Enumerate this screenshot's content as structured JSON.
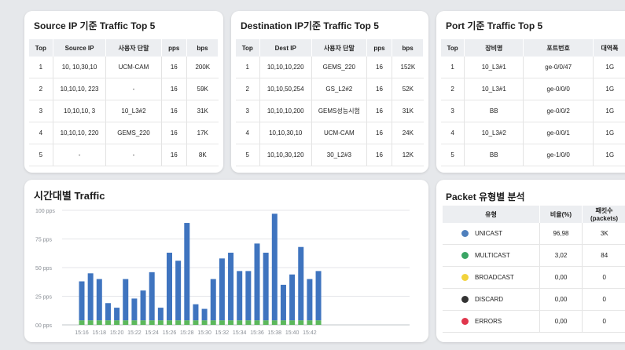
{
  "source_card": {
    "title": "Source IP 기준 Traffic Top 5",
    "headers": [
      "Top",
      "Source IP",
      "사용자 단말",
      "pps",
      "bps"
    ],
    "rows": [
      [
        "1",
        "10, 10,30,10",
        "UCM-CAM",
        "16",
        "200K"
      ],
      [
        "2",
        "10,10,10, 223",
        "-",
        "16",
        "59K"
      ],
      [
        "3",
        "10,10,10, 3",
        "10_L3#2",
        "16",
        "31K"
      ],
      [
        "4",
        "10,10,10, 220",
        "GEMS_220",
        "16",
        "17K"
      ],
      [
        "5",
        "-",
        "-",
        "16",
        "8K"
      ]
    ]
  },
  "dest_card": {
    "title": "Destination IP기준 Traffic Top 5",
    "headers": [
      "Top",
      "Dest IP",
      "사용자 단말",
      "pps",
      "bps"
    ],
    "rows": [
      [
        "1",
        "10,10,10,220",
        "GEMS_220",
        "16",
        "152K"
      ],
      [
        "2",
        "10,10,50,254",
        "GS_L2#2",
        "16",
        "52K"
      ],
      [
        "3",
        "10,10,10,200",
        "GEMS성능시험",
        "16",
        "31K"
      ],
      [
        "4",
        "10,10,30,10",
        "UCM-CAM",
        "16",
        "24K"
      ],
      [
        "5",
        "10,10,30,120",
        "30_L2#3",
        "16",
        "12K"
      ]
    ]
  },
  "port_card": {
    "title": "Port 기준 Traffic Top 5",
    "headers": [
      "Top",
      "장비명",
      "포트번호",
      "대역폭"
    ],
    "rows": [
      [
        "1",
        "10_L3#1",
        "ge-0/0/47",
        "1G"
      ],
      [
        "2",
        "10_L3#1",
        "ge-0/0/0",
        "1G"
      ],
      [
        "3",
        "BB",
        "ge-0/0/2",
        "1G"
      ],
      [
        "4",
        "10_L3#2",
        "ge-0/0/1",
        "1G"
      ],
      [
        "5",
        "BB",
        "ge-1/0/0",
        "1G"
      ]
    ]
  },
  "packet_card": {
    "title": "Packet 유형별 분석",
    "headers": [
      "유형",
      "비율(%)",
      "패킷수(packets)"
    ],
    "rows": [
      {
        "type": "UNICAST",
        "ratio": "96,98",
        "count": "3K",
        "color": "#4f80bd"
      },
      {
        "type": "MULTICAST",
        "ratio": "3,02",
        "count": "84",
        "color": "#3aa565"
      },
      {
        "type": "BROADCAST",
        "ratio": "0,00",
        "count": "0",
        "color": "#f2d33c"
      },
      {
        "type": "DISCARD",
        "ratio": "0,00",
        "count": "0",
        "color": "#333333"
      },
      {
        "type": "ERRORS",
        "ratio": "0,00",
        "count": "0",
        "color": "#e0364c"
      }
    ]
  },
  "chart_card": {
    "title": "시간대별 Traffic"
  },
  "chart_data": {
    "type": "bar",
    "title": "시간대별 Traffic",
    "ylim": [
      0,
      100
    ],
    "y_ticks": [
      "00 pps",
      "25 pps",
      "50 pps",
      "75 pps",
      "100 pps"
    ],
    "y_tick_values": [
      0,
      25,
      50,
      75,
      100
    ],
    "x_tick_labels": [
      "15:16",
      "15:18",
      "15:20",
      "15:22",
      "15:24",
      "15:26",
      "15:28",
      "15:30",
      "15:32",
      "15:34",
      "15:36",
      "15:38",
      "15:40",
      "15:42"
    ],
    "stacked": true,
    "series": [
      {
        "color": "#3f74bf",
        "values": [
          34,
          41,
          36,
          15,
          11,
          36,
          19,
          26,
          42,
          11,
          59,
          52,
          85,
          14,
          10,
          36,
          54,
          59,
          43,
          43,
          67,
          59,
          93,
          31,
          40,
          64,
          36,
          43
        ]
      },
      {
        "color": "#5cb85c",
        "values": [
          4,
          4,
          4,
          4,
          4,
          4,
          4,
          4,
          4,
          4,
          4,
          4,
          4,
          4,
          4,
          4,
          4,
          4,
          4,
          4,
          4,
          4,
          4,
          4,
          4,
          4,
          4,
          4
        ]
      }
    ],
    "colors": {
      "upper": "#3f74bf",
      "base": "#5cb85c"
    }
  }
}
